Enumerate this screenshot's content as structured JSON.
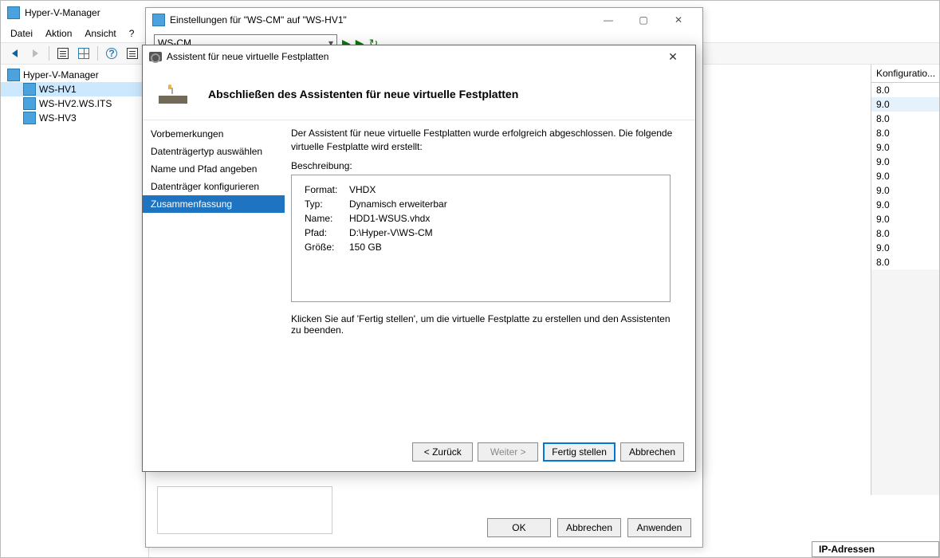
{
  "main": {
    "title": "Hyper-V-Manager",
    "menu": {
      "file": "Datei",
      "action": "Aktion",
      "view": "Ansicht",
      "help": "?"
    }
  },
  "tree": {
    "root": "Hyper-V-Manager",
    "nodes": [
      "WS-HV1",
      "WS-HV2.WS.ITS",
      "WS-HV3"
    ]
  },
  "right": {
    "header": "Konfiguratio...",
    "values": [
      "8.0",
      "9.0",
      "8.0",
      "8.0",
      "9.0",
      "9.0",
      "9.0",
      "9.0",
      "9.0",
      "9.0",
      "8.0",
      "9.0",
      "8.0"
    ],
    "footer": "IP-Adressen"
  },
  "settings": {
    "title": "Einstellungen für \"WS-CM\" auf \"WS-HV1\"",
    "combo": "WS-CM",
    "buttons": {
      "ok": "OK",
      "cancel": "Abbrechen",
      "apply": "Anwenden"
    }
  },
  "wizard": {
    "title": "Assistent für neue virtuelle Festplatten",
    "header": "Abschließen des Assistenten für neue virtuelle Festplatten",
    "steps": [
      "Vorbemerkungen",
      "Datenträgertyp auswählen",
      "Name und Pfad angeben",
      "Datenträger konfigurieren",
      "Zusammenfassung"
    ],
    "intro": "Der Assistent für neue virtuelle Festplatten wurde erfolgreich abgeschlossen. Die folgende virtuelle Festplatte wird erstellt:",
    "desc_label": "Beschreibung:",
    "summary": {
      "format_k": "Format:",
      "format_v": "VHDX",
      "typ_k": "Typ:",
      "typ_v": "Dynamisch erweiterbar",
      "name_k": "Name:",
      "name_v": "HDD1-WSUS.vhdx",
      "pfad_k": "Pfad:",
      "pfad_v": "D:\\Hyper-V\\WS-CM",
      "size_k": "Größe:",
      "size_v": "150 GB"
    },
    "hint": "Klicken Sie auf 'Fertig stellen', um die virtuelle Festplatte zu erstellen und den Assistenten zu beenden.",
    "buttons": {
      "back": "< Zurück",
      "next": "Weiter >",
      "finish": "Fertig stellen",
      "cancel": "Abbrechen"
    }
  }
}
